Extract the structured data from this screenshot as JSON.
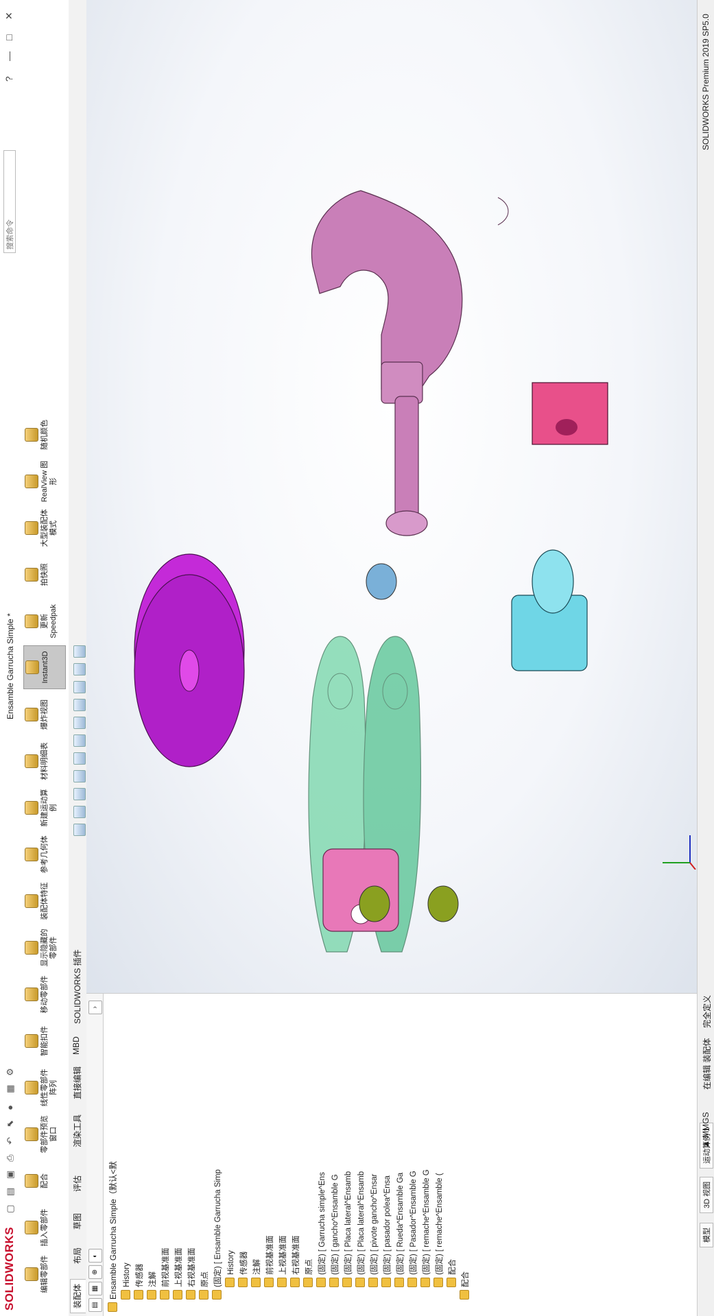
{
  "app": {
    "logo": "SOLIDWORKS",
    "title": "Ensamble Garrucha Simple *",
    "search_placeholder": "搜索命令",
    "window_controls": [
      "?",
      "—",
      "□",
      "✕"
    ]
  },
  "ribbon": {
    "buttons": [
      {
        "label": "编辑零部件",
        "icon": "edit-component-icon"
      },
      {
        "label": "插入零部件",
        "icon": "insert-component-icon"
      },
      {
        "label": "配合",
        "icon": "mate-icon"
      },
      {
        "label": "零部件预览窗口",
        "icon": "component-preview-icon"
      },
      {
        "label": "线性零部件阵列",
        "icon": "linear-pattern-icon"
      },
      {
        "label": "智能扣件",
        "icon": "smart-fastener-icon"
      },
      {
        "label": "移动零部件",
        "icon": "move-component-icon"
      },
      {
        "label": "显示隐藏的零部件",
        "icon": "show-hidden-icon"
      },
      {
        "label": "装配体特征",
        "icon": "assembly-feature-icon"
      },
      {
        "label": "参考几何体",
        "icon": "reference-geometry-icon"
      },
      {
        "label": "新建运动算例",
        "icon": "new-motion-study-icon"
      },
      {
        "label": "材料明细表",
        "icon": "bom-icon"
      },
      {
        "label": "爆炸视图",
        "icon": "exploded-view-icon"
      },
      {
        "label": "Instant3D",
        "icon": "instant3d-icon",
        "active": true
      },
      {
        "label": "更新 Speedpak",
        "icon": "speedpak-icon"
      },
      {
        "label": "拍快照",
        "icon": "snapshot-icon"
      },
      {
        "label": "大型装配体模式",
        "icon": "large-assembly-icon"
      },
      {
        "label": "RealView 图形",
        "icon": "realview-icon"
      },
      {
        "label": "随机颜色",
        "icon": "random-color-icon"
      }
    ]
  },
  "command_tabs": [
    {
      "label": "装配体",
      "active": true
    },
    {
      "label": "布局"
    },
    {
      "label": "草图"
    },
    {
      "label": "评估"
    },
    {
      "label": "渲染工具"
    },
    {
      "label": "直接编辑"
    },
    {
      "label": "MBD"
    },
    {
      "label": "SOLIDWORKS 插件"
    }
  ],
  "feature_tree": {
    "root": "Ensamble Garrucha Simple（默认<默",
    "items": [
      {
        "label": "History",
        "indent": 1,
        "icon": "history-icon"
      },
      {
        "label": "传感器",
        "indent": 1,
        "icon": "sensor-icon"
      },
      {
        "label": "注解",
        "indent": 1,
        "icon": "annotation-icon"
      },
      {
        "label": "前视基准面",
        "indent": 1,
        "icon": "plane-icon"
      },
      {
        "label": "上视基准面",
        "indent": 1,
        "icon": "plane-icon"
      },
      {
        "label": "右视基准面",
        "indent": 1,
        "icon": "plane-icon"
      },
      {
        "label": "原点",
        "indent": 1,
        "icon": "origin-icon"
      },
      {
        "label": "(固定) [ Ensamble Garrucha Simp",
        "indent": 1,
        "icon": "subassembly-icon"
      },
      {
        "label": "History",
        "indent": 2,
        "icon": "history-icon"
      },
      {
        "label": "传感器",
        "indent": 2,
        "icon": "sensor-icon"
      },
      {
        "label": "注解",
        "indent": 2,
        "icon": "annotation-icon"
      },
      {
        "label": "前视基准面",
        "indent": 2,
        "icon": "plane-icon"
      },
      {
        "label": "上视基准面",
        "indent": 2,
        "icon": "plane-icon"
      },
      {
        "label": "右视基准面",
        "indent": 2,
        "icon": "plane-icon"
      },
      {
        "label": "原点",
        "indent": 2,
        "icon": "origin-icon"
      },
      {
        "label": "(固定) [ Garrucha simple^Ens",
        "indent": 2,
        "icon": "part-icon"
      },
      {
        "label": "(固定) [ gancho^Ensamble G",
        "indent": 2,
        "icon": "part-icon"
      },
      {
        "label": "(固定) [ Placa lateral^Ensamb",
        "indent": 2,
        "icon": "part-icon"
      },
      {
        "label": "(固定) [ Placa lateral^Ensamb",
        "indent": 2,
        "icon": "part-icon"
      },
      {
        "label": "(固定) [ pivote gancho^Ensar",
        "indent": 2,
        "icon": "part-icon"
      },
      {
        "label": "(固定) [ pasador polea^Ensa",
        "indent": 2,
        "icon": "part-icon"
      },
      {
        "label": "(固定) [ Rueda^Ensamble Ga",
        "indent": 2,
        "icon": "part-icon"
      },
      {
        "label": "(固定) [ Pasador^Ensamble G",
        "indent": 2,
        "icon": "part-icon"
      },
      {
        "label": "(固定) [ remache^Ensamble G",
        "indent": 2,
        "icon": "part-icon"
      },
      {
        "label": "(固定) [ remache^Ensamble (",
        "indent": 2,
        "icon": "part-icon"
      },
      {
        "label": "配合",
        "indent": 2,
        "icon": "mates-icon"
      },
      {
        "label": "配合",
        "indent": 1,
        "icon": "mates-icon"
      }
    ]
  },
  "status_bar": {
    "app_version": "SOLIDWORKS Premium 2019 SP5.0",
    "tabs": [
      "模型",
      "3D 视图",
      "运动算例 1"
    ],
    "definition": "完全定义",
    "editing": "在编辑 装配体",
    "units": "MMGS",
    "units_arrow": "▲"
  },
  "colors": {
    "brand": "#c8102e",
    "hook": "#c97fb8",
    "shackle": "#e878b8",
    "plates": "#6fd4a4",
    "wheel": "#b020c8",
    "pin": "#6fd6e6",
    "block": "#e8508a",
    "rivet": "#8aa020"
  }
}
